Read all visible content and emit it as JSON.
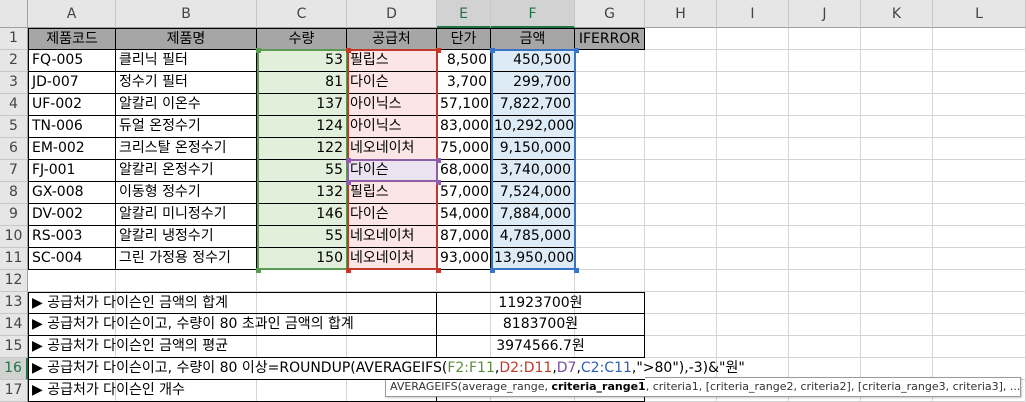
{
  "columns": [
    "A",
    "B",
    "C",
    "D",
    "E",
    "F",
    "G",
    "H",
    "I",
    "J",
    "K",
    "L"
  ],
  "rows": [
    "1",
    "2",
    "3",
    "4",
    "5",
    "6",
    "7",
    "8",
    "9",
    "10",
    "11",
    "12",
    "13",
    "14",
    "15",
    "16",
    "17"
  ],
  "headers": {
    "a": "제품코드",
    "b": "제품명",
    "c": "수량",
    "d": "공급처",
    "e": "단가",
    "f": "금액",
    "g": "IFERROR"
  },
  "data": [
    {
      "code": "FQ-005",
      "name": "클리닉 필터",
      "qty": "53",
      "supplier": "필립스",
      "price": "8,500",
      "amount": "450,500"
    },
    {
      "code": "JD-007",
      "name": "정수기 필터",
      "qty": "81",
      "supplier": "다이슨",
      "price": "3,700",
      "amount": "299,700"
    },
    {
      "code": "UF-002",
      "name": "알칼리 이온수",
      "qty": "137",
      "supplier": "아이닉스",
      "price": "57,100",
      "amount": "7,822,700"
    },
    {
      "code": "TN-006",
      "name": "듀얼 온정수기",
      "qty": "124",
      "supplier": "아이닉스",
      "price": "83,000",
      "amount": "10,292,000"
    },
    {
      "code": "EM-002",
      "name": "크리스탈 온정수기",
      "qty": "122",
      "supplier": "네오네이처",
      "price": "75,000",
      "amount": "9,150,000"
    },
    {
      "code": "FJ-001",
      "name": "알칼리 온정수기",
      "qty": "55",
      "supplier": "다이슨",
      "price": "68,000",
      "amount": "3,740,000"
    },
    {
      "code": "GX-008",
      "name": "이동형 정수기",
      "qty": "132",
      "supplier": "필립스",
      "price": "57,000",
      "amount": "7,524,000"
    },
    {
      "code": "DV-002",
      "name": "알칼리 미니정수기",
      "qty": "146",
      "supplier": "다이슨",
      "price": "54,000",
      "amount": "7,884,000"
    },
    {
      "code": "RS-003",
      "name": "알칼리 냉정수기",
      "qty": "55",
      "supplier": "네오네이처",
      "price": "87,000",
      "amount": "4,785,000"
    },
    {
      "code": "SC-004",
      "name": "그린 가정용 정수기",
      "qty": "150",
      "supplier": "네오네이처",
      "price": "93,000",
      "amount": "13,950,000"
    }
  ],
  "summary": [
    {
      "label": "▶ 공급처가 다이슨인 금액의 합계",
      "value": "11923700원"
    },
    {
      "label": "▶ 공급처가 다이슨이고, 수량이 80 초과인 금액의 합계",
      "value": "8183700원"
    },
    {
      "label": "▶ 공급처가 다이슨인 금액의 평균",
      "value": "3974566.7원"
    },
    {
      "label": "▶ 공급처가 다이슨이고, 수량이 80 이상",
      "value": ""
    },
    {
      "label": "▶ 공급처가 다이슨인 개수",
      "value": ""
    }
  ],
  "formula": {
    "prefix": "=ROUNDUP(AVERAGEIFS(",
    "r1": "F2:F11",
    "c1": ",",
    "r2": "D2:D11",
    "c2": ",",
    "r3": "D7",
    "c3": ",",
    "r4": "C2:C11",
    "suffix": ",\">80\"),-3)&\"원\""
  },
  "tooltip": {
    "fn": "AVERAGEIFS(average_range, ",
    "bold": "criteria_range1",
    "rest": ", criteria1, [criteria_range2, criteria2], [criteria_range3, criteria3], ...)"
  }
}
